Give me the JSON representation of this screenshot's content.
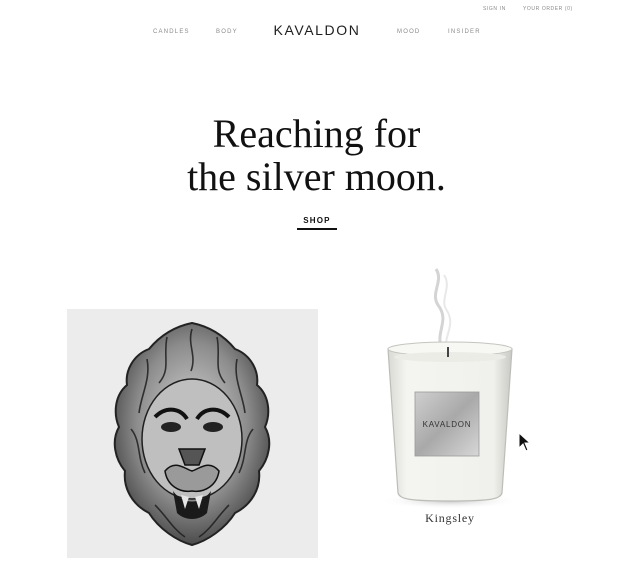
{
  "header": {
    "sign_in": "SIGN IN",
    "your_order": "YOUR ORDER (0)",
    "logo": "KAVALDON",
    "nav": [
      "CANDLES",
      "BODY",
      "MOOD",
      "INSIDER"
    ]
  },
  "hero": {
    "headline_line1": "Reaching for",
    "headline_line2": "the silver moon.",
    "cta": "SHOP"
  },
  "products": {
    "candle": {
      "label_brand": "KAVALDON",
      "name": "Kingsley"
    }
  },
  "icons": {
    "lion_image": "lion-head-sculpture",
    "candle_image": "candle-jar",
    "cursor": "mouse-pointer-icon"
  }
}
